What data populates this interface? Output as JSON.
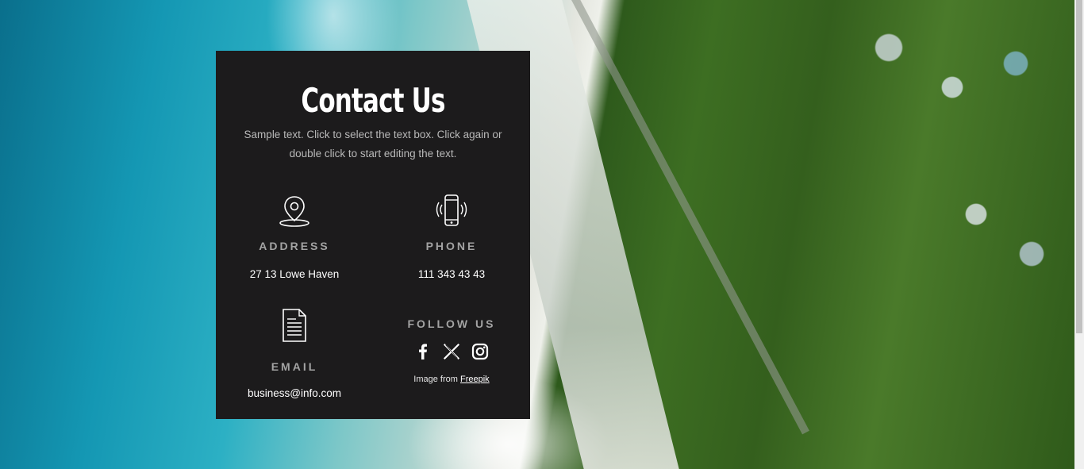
{
  "contact": {
    "title": "Contact Us",
    "subtitle": "Sample text. Click to select the text box. Click again or double click to start editing the text.",
    "address": {
      "icon": "map-pin-icon",
      "label": "ADDRESS",
      "value": "27 13 Lowe Haven"
    },
    "phone": {
      "icon": "phone-icon",
      "label": "PHONE",
      "value": "111 343 43 43"
    },
    "email": {
      "icon": "document-icon",
      "label": "EMAIL",
      "value": "business@info.com"
    },
    "follow": {
      "label": "FOLLOW US",
      "icons": [
        "facebook-icon",
        "x-icon",
        "instagram-icon"
      ]
    },
    "credit": {
      "prefix": "Image from",
      "link": "Freepik"
    }
  },
  "colors": {
    "card_bg": "#1c1b1c",
    "label": "#a3a3a3",
    "text": "#ffffff",
    "subtitle": "#b9b9b9"
  }
}
